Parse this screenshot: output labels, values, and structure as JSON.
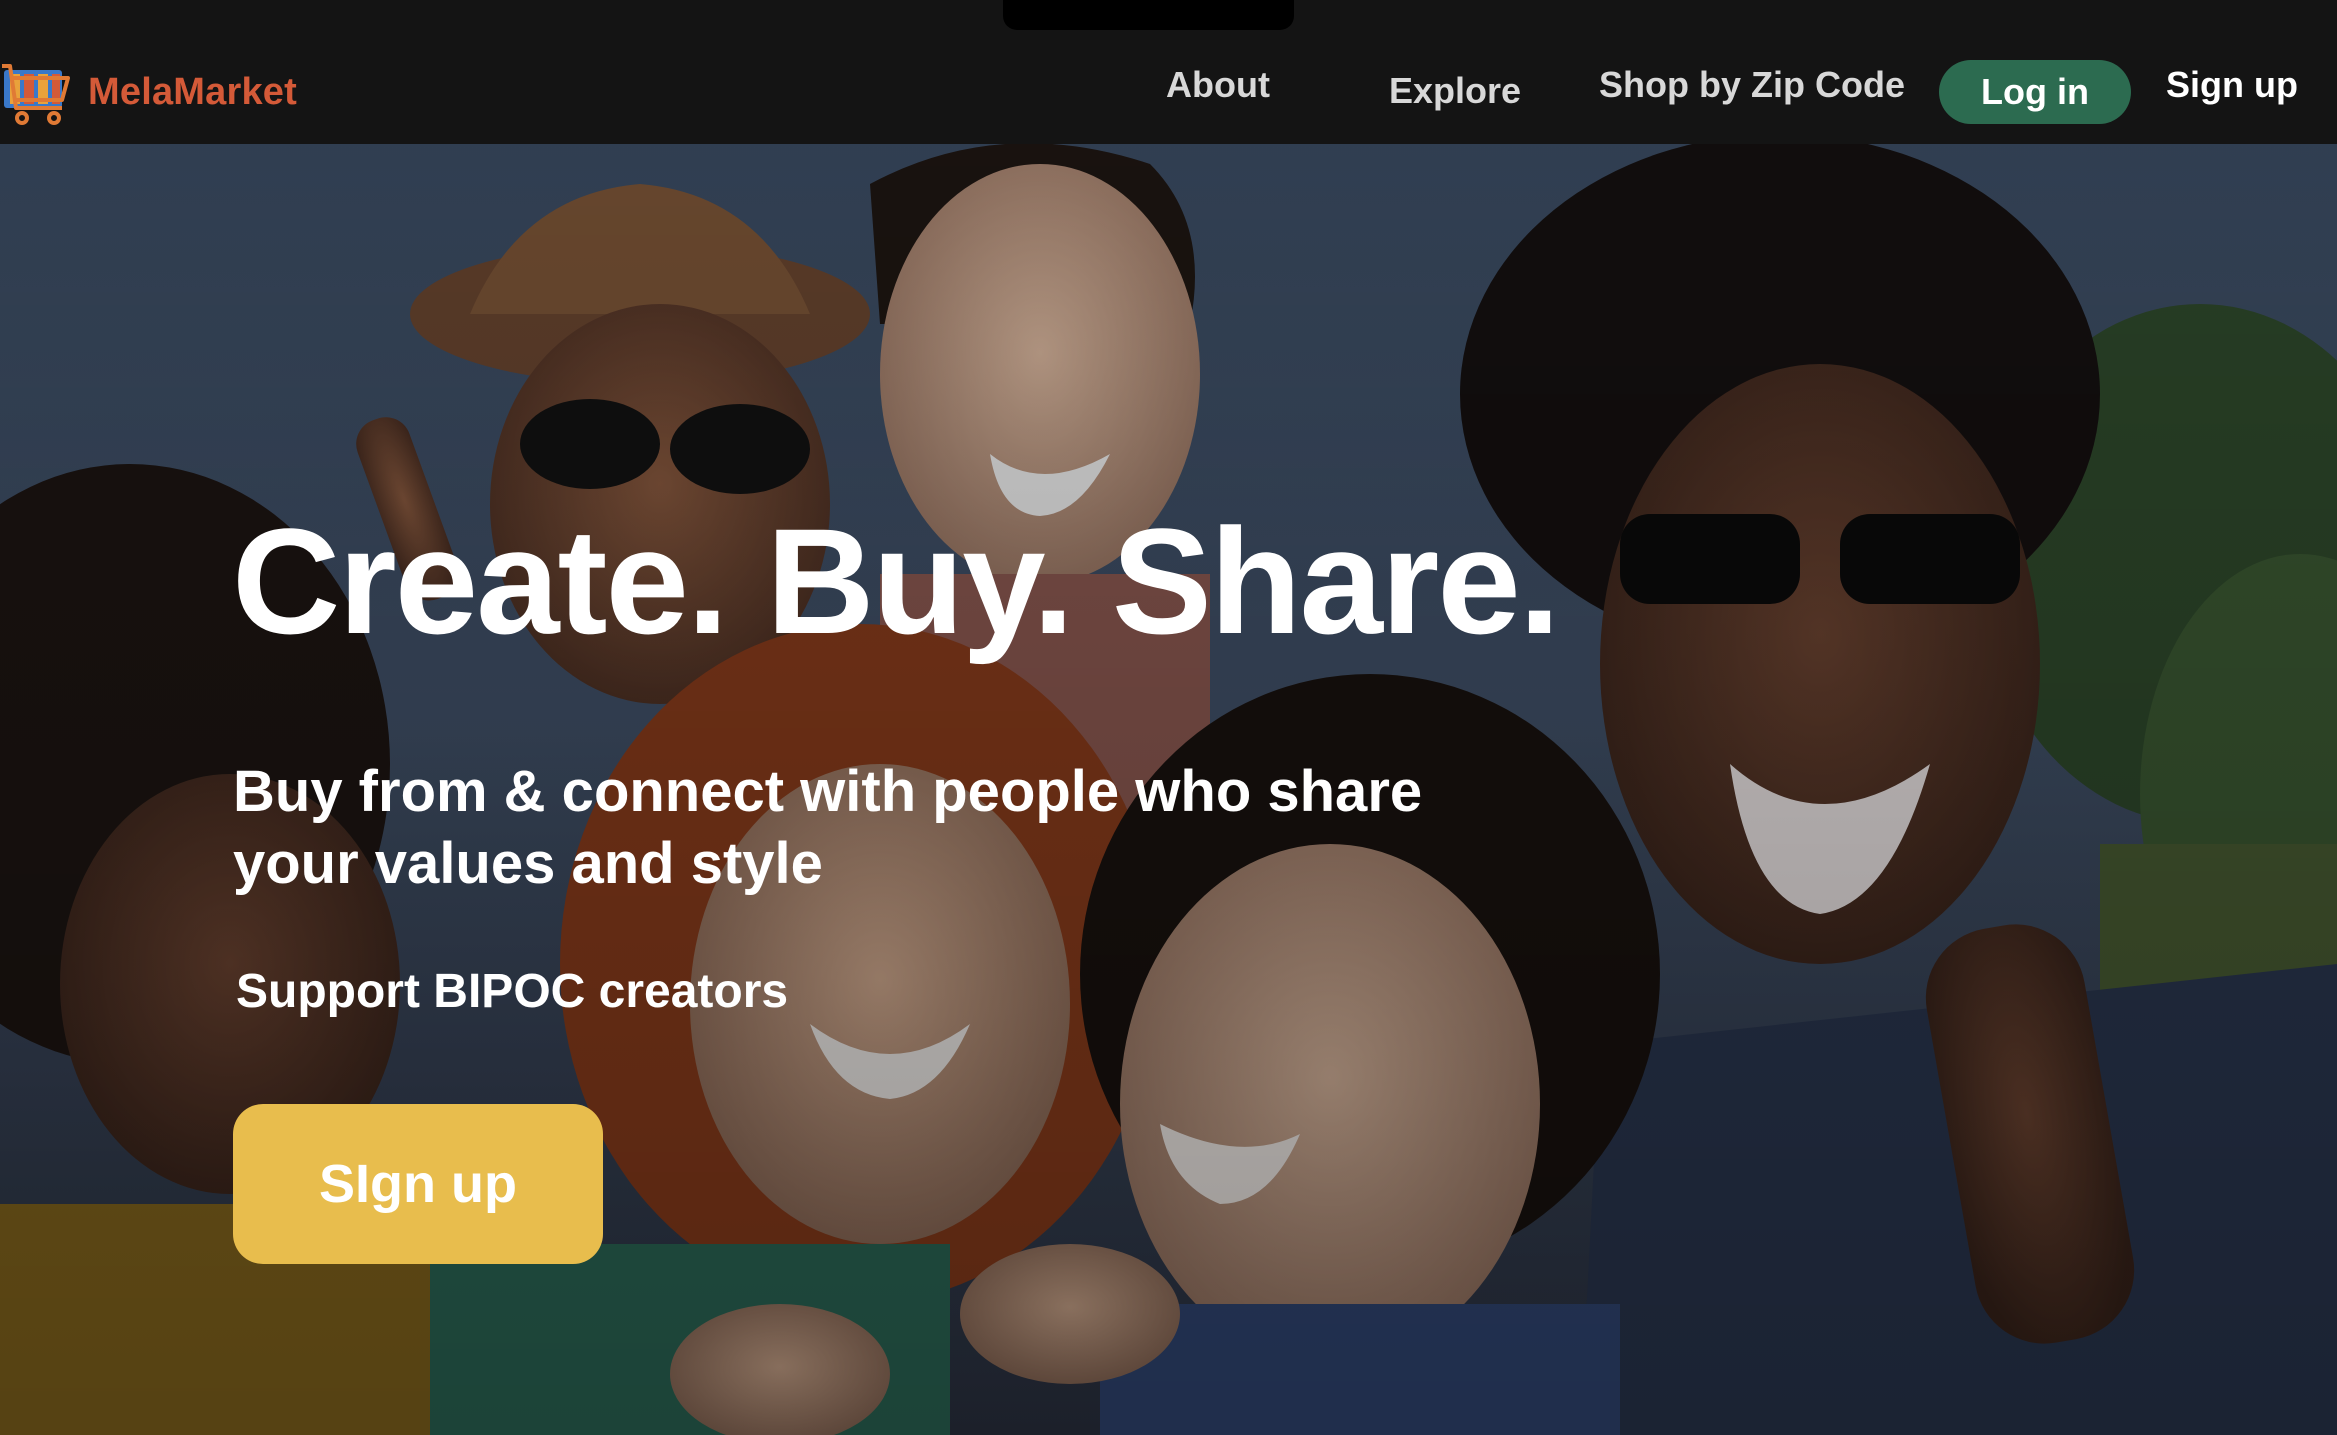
{
  "brand": {
    "name": "MelaMarket",
    "logo_icon": "shopping-cart-icon",
    "color": "#d45a38"
  },
  "nav": {
    "about": "About",
    "explore": "Explore",
    "shop_by_zip": "Shop by Zip Code",
    "login": "Log in",
    "signup": "Sign up"
  },
  "hero": {
    "title": "Create. Buy. Share.",
    "subtitle": "Buy from & connect with people who share your values and style",
    "support": "Support BIPOC creators",
    "cta": "SIgn up",
    "image": "group-photo"
  },
  "colors": {
    "nav_background": "#141414",
    "login_button": "#2c6b50",
    "cta_button": "#e8bd4d",
    "text": "#ffffff"
  }
}
